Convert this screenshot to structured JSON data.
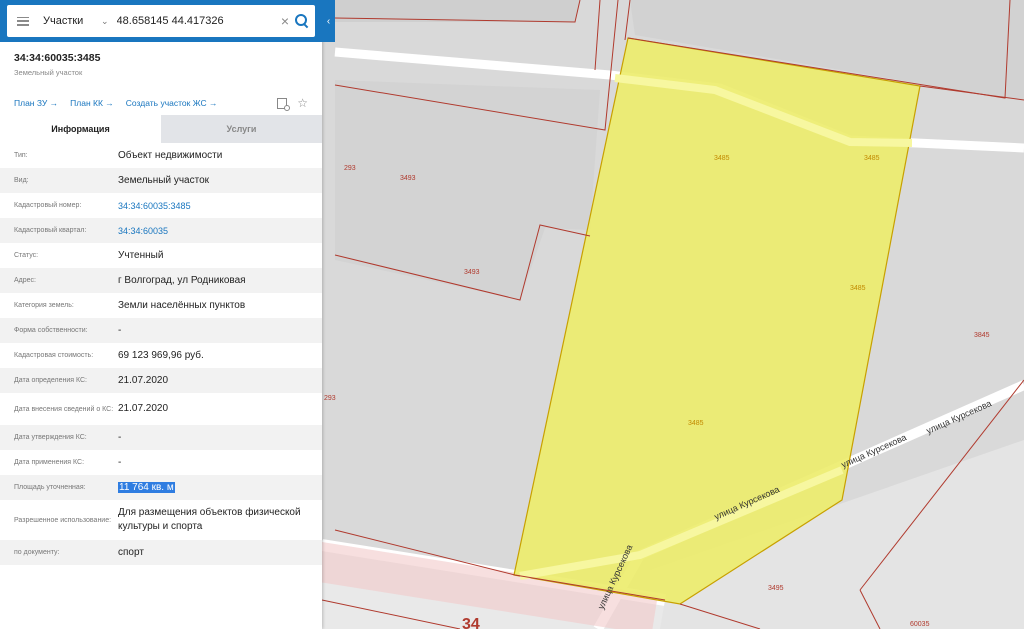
{
  "search": {
    "mode": "Участки",
    "value": "48.658145 44.417326"
  },
  "object": {
    "number": "34:34:60035:3485",
    "type": "Земельный участок"
  },
  "links": {
    "plan_zu": "План ЗУ →",
    "plan_kk": "План КК →",
    "create_zs": "Создать участок ЖС →"
  },
  "tabs": {
    "info": "Информация",
    "services": "Услуги"
  },
  "rows": [
    {
      "label": "Тип:",
      "value": "Объект недвижимости"
    },
    {
      "label": "Вид:",
      "value": "Земельный участок"
    },
    {
      "label": "Кадастровый номер:",
      "value": "34:34:60035:3485"
    },
    {
      "label": "Кадастровый квартал:",
      "value": "34:34:60035"
    },
    {
      "label": "Статус:",
      "value": "Учтенный"
    },
    {
      "label": "Адрес:",
      "value": "г Волгоград, ул Родниковая"
    },
    {
      "label": "Категория земель:",
      "value": "Земли населённых пунктов"
    },
    {
      "label": "Форма собственности:",
      "value": "-"
    },
    {
      "label": "Кадастровая стоимость:",
      "value": "69 123 969,96 руб."
    },
    {
      "label": "Дата определения КС:",
      "value": "21.07.2020"
    },
    {
      "label": "Дата внесения сведений о КС:",
      "value": "21.07.2020"
    },
    {
      "label": "Дата утверждения КС:",
      "value": "-"
    },
    {
      "label": "Дата применения КС:",
      "value": "-"
    },
    {
      "label": "Площадь уточненная:",
      "value": "11 764 кв. м"
    },
    {
      "label": "Разрешенное использование:",
      "value": "Для размещения объектов физической культуры и спорта"
    },
    {
      "label": "по документу:",
      "value": "спорт"
    }
  ],
  "map": {
    "parcel_labels": [
      "293",
      "3493",
      "3493",
      "293",
      "3485",
      "3485",
      "3485",
      "3485",
      "3845",
      "3495",
      "60035",
      "34"
    ],
    "streets": [
      "улица Курсекова",
      "улица Курсекова",
      "улица Курсекова",
      "улица Курсекова"
    ],
    "colors": {
      "selected_fill": "#ecec6a",
      "selected_border": "#c8a000",
      "parcel_border": "#b03a2e",
      "road": "#ffffff",
      "highlight_road": "#f7f7a0"
    }
  },
  "ui": {
    "collapse_glyph": "‹"
  }
}
